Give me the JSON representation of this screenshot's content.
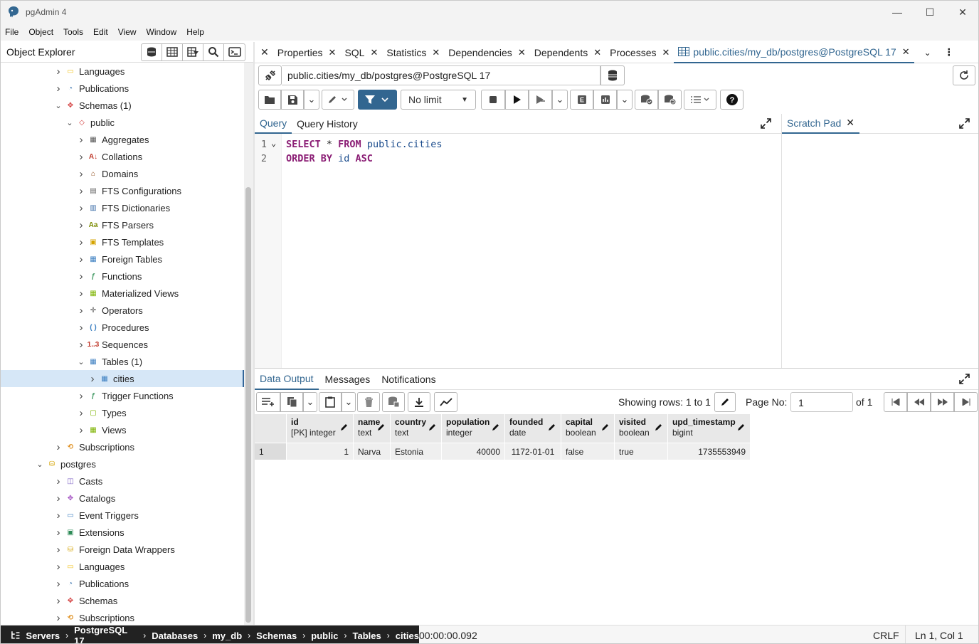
{
  "window": {
    "title": "pgAdmin 4",
    "minimize": "—",
    "maximize": "☐",
    "close": "✕"
  },
  "menu": [
    "File",
    "Object",
    "Tools",
    "Edit",
    "View",
    "Window",
    "Help"
  ],
  "object_explorer": {
    "title": "Object Explorer"
  },
  "tree": [
    {
      "label": "Languages",
      "level": 0,
      "state": "collapsed",
      "icon": "languages-icon"
    },
    {
      "label": "Publications",
      "level": 0,
      "state": "collapsed",
      "icon": "publications-icon"
    },
    {
      "label": "Schemas (1)",
      "level": 0,
      "state": "expanded",
      "icon": "schemas-icon"
    },
    {
      "label": "public",
      "level": 1,
      "state": "expanded",
      "icon": "schema-icon"
    },
    {
      "label": "Aggregates",
      "level": 2,
      "state": "collapsed",
      "icon": "aggregates-icon"
    },
    {
      "label": "Collations",
      "level": 2,
      "state": "collapsed",
      "icon": "collations-icon"
    },
    {
      "label": "Domains",
      "level": 2,
      "state": "collapsed",
      "icon": "domains-icon"
    },
    {
      "label": "FTS Configurations",
      "level": 2,
      "state": "collapsed",
      "icon": "fts-configurations-icon"
    },
    {
      "label": "FTS Dictionaries",
      "level": 2,
      "state": "collapsed",
      "icon": "fts-dictionaries-icon"
    },
    {
      "label": "FTS Parsers",
      "level": 2,
      "state": "collapsed",
      "icon": "fts-parsers-icon"
    },
    {
      "label": "FTS Templates",
      "level": 2,
      "state": "collapsed",
      "icon": "fts-templates-icon"
    },
    {
      "label": "Foreign Tables",
      "level": 2,
      "state": "collapsed",
      "icon": "foreign-tables-icon"
    },
    {
      "label": "Functions",
      "level": 2,
      "state": "collapsed",
      "icon": "functions-icon"
    },
    {
      "label": "Materialized Views",
      "level": 2,
      "state": "collapsed",
      "icon": "materialized-views-icon"
    },
    {
      "label": "Operators",
      "level": 2,
      "state": "collapsed",
      "icon": "operators-icon"
    },
    {
      "label": "Procedures",
      "level": 2,
      "state": "collapsed",
      "icon": "procedures-icon"
    },
    {
      "label": "Sequences",
      "level": 2,
      "state": "collapsed",
      "icon": "sequences-icon"
    },
    {
      "label": "Tables (1)",
      "level": 2,
      "state": "expanded",
      "icon": "tables-icon"
    },
    {
      "label": "cities",
      "level": 3,
      "state": "collapsed",
      "icon": "table-icon",
      "selected": true
    },
    {
      "label": "Trigger Functions",
      "level": 2,
      "state": "collapsed",
      "icon": "trigger-functions-icon"
    },
    {
      "label": "Types",
      "level": 2,
      "state": "collapsed",
      "icon": "types-icon"
    },
    {
      "label": "Views",
      "level": 2,
      "state": "collapsed",
      "icon": "views-icon"
    },
    {
      "label": "Subscriptions",
      "level": 0,
      "state": "collapsed",
      "icon": "subscriptions-icon"
    },
    {
      "label": "postgres",
      "level": -1,
      "state": "expanded",
      "icon": "database-icon"
    },
    {
      "label": "Casts",
      "level": 0,
      "state": "collapsed",
      "icon": "casts-icon"
    },
    {
      "label": "Catalogs",
      "level": 0,
      "state": "collapsed",
      "icon": "catalogs-icon"
    },
    {
      "label": "Event Triggers",
      "level": 0,
      "state": "collapsed",
      "icon": "event-triggers-icon"
    },
    {
      "label": "Extensions",
      "level": 0,
      "state": "collapsed",
      "icon": "extensions-icon"
    },
    {
      "label": "Foreign Data Wrappers",
      "level": 0,
      "state": "collapsed",
      "icon": "foreign-data-wrappers-icon"
    },
    {
      "label": "Languages",
      "level": 0,
      "state": "collapsed",
      "icon": "languages-icon"
    },
    {
      "label": "Publications",
      "level": 0,
      "state": "collapsed",
      "icon": "publications-icon"
    },
    {
      "label": "Schemas",
      "level": 0,
      "state": "collapsed",
      "icon": "schemas-icon"
    },
    {
      "label": "Subscriptions",
      "level": 0,
      "state": "collapsed",
      "icon": "subscriptions-icon"
    }
  ],
  "tabs": [
    {
      "label": "Properties"
    },
    {
      "label": "SQL"
    },
    {
      "label": "Statistics"
    },
    {
      "label": "Dependencies"
    },
    {
      "label": "Dependents"
    },
    {
      "label": "Processes"
    },
    {
      "label": "public.cities/my_db/postgres@PostgreSQL 17",
      "active": true
    }
  ],
  "connection": {
    "value": "public.cities/my_db/postgres@PostgreSQL 17"
  },
  "toolbar": {
    "limit": "No limit"
  },
  "query_panel": {
    "tabs": [
      "Query",
      "Query History"
    ]
  },
  "scratch_pad": {
    "title": "Scratch Pad"
  },
  "editor": {
    "lines": [
      {
        "num": "1",
        "tokens": [
          {
            "t": "SELECT",
            "c": "kw"
          },
          {
            "t": " * ",
            "c": ""
          },
          {
            "t": "FROM",
            "c": "kw"
          },
          {
            "t": " public.cities",
            "c": "id"
          }
        ]
      },
      {
        "num": "2",
        "tokens": [
          {
            "t": "ORDER BY",
            "c": "kw"
          },
          {
            "t": " id ",
            "c": "id"
          },
          {
            "t": "ASC",
            "c": "kw"
          }
        ]
      }
    ]
  },
  "data_panel": {
    "tabs": [
      "Data Output",
      "Messages",
      "Notifications"
    ]
  },
  "pagination": {
    "rows": "Showing rows: 1 to 1",
    "page_label": "Page No:",
    "page": "1",
    "of": "of 1"
  },
  "grid": {
    "columns": [
      {
        "name": "id",
        "type": "[PK] integer"
      },
      {
        "name": "name",
        "type": "text"
      },
      {
        "name": "country",
        "type": "text"
      },
      {
        "name": "population",
        "type": "integer"
      },
      {
        "name": "founded",
        "type": "date"
      },
      {
        "name": "capital",
        "type": "boolean"
      },
      {
        "name": "visited",
        "type": "boolean"
      },
      {
        "name": "upd_timestamp",
        "type": "bigint"
      }
    ],
    "rows": [
      {
        "rownum": "1",
        "cells": [
          "1",
          "Narva",
          "Estonia",
          "40000",
          "1172-01-01",
          "false",
          "true",
          "1735553949"
        ]
      }
    ]
  },
  "status": {
    "breadcrumbs": [
      "Servers",
      "PostgreSQL 17",
      "Databases",
      "my_db",
      "Schemas",
      "public",
      "Tables",
      "cities"
    ],
    "time": "00:00:00.092",
    "eol": "CRLF",
    "position": "Ln 1, Col 1"
  },
  "colors": {
    "accent": "#326690",
    "selection": "#d6e7f7",
    "filter_button": "#326690"
  }
}
